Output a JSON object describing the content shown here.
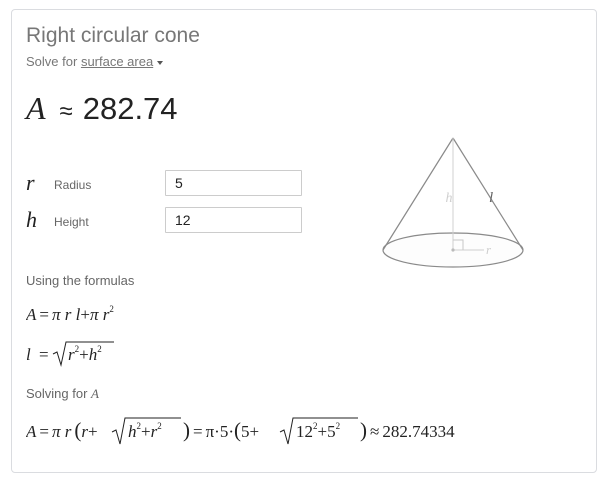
{
  "header": {
    "title": "Right circular cone",
    "solve_prefix": "Solve for",
    "solve_selected": "surface area"
  },
  "result": {
    "symbol": "A",
    "approx": "≈",
    "value": "282.74"
  },
  "inputs": [
    {
      "symbol": "r",
      "label": "Radius",
      "value": "5"
    },
    {
      "symbol": "h",
      "label": "Height",
      "value": "12"
    }
  ],
  "diagram": {
    "height_label": "h",
    "slant_label": "l",
    "radius_label": "r"
  },
  "formulas_heading": "Using the formulas",
  "formula_1": {
    "lhs": "A",
    "eq": "=",
    "t1": "π r l",
    "plus": "+",
    "t2": "π r",
    "exp": "2"
  },
  "formula_2": {
    "lhs": "l",
    "eq": "=",
    "a": "r",
    "a_exp": "2",
    "plus": "+",
    "b": "h",
    "b_exp": "2"
  },
  "solving_heading": "Solving for",
  "solving_var": "A",
  "final": {
    "lhs": "A",
    "eq1": "=",
    "pi_r": "π r",
    "lp1": "(",
    "r": "r",
    "plus1": "+",
    "h": "h",
    "h_exp": "2",
    "plus2": "+",
    "r2": "r",
    "r2_exp": "2",
    "rp1": ")",
    "eq2": "=",
    "pi5": "π·5·",
    "lp2": "(",
    "five": "5",
    "plus3": "+",
    "twelve": "12",
    "twelve_exp": "2",
    "plus4": "+",
    "five2": "5",
    "five2_exp": "2",
    "rp2": ")",
    "approx": "≈",
    "value": "282.74334"
  }
}
